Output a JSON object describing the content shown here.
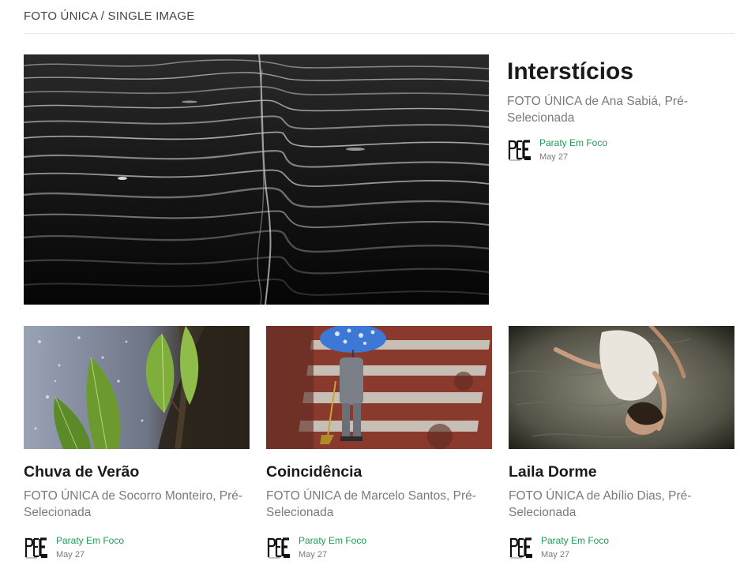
{
  "section": {
    "title": "FOTO ÚNICA / SINGLE IMAGE"
  },
  "featured": {
    "title": "Interstícios",
    "description": "FOTO ÚNICA de Ana Sabiá, Pré-Selecionada",
    "author": "Paraty Em Foco",
    "date": "May 27",
    "image": "black-and-white-water-ripples"
  },
  "posts": [
    {
      "title": "Chuva de Verão",
      "description": "FOTO ÚNICA de Socorro Monteiro, Pré-Selecionada",
      "author": "Paraty Em Foco",
      "date": "May 27",
      "image": "green-leaves-in-rain"
    },
    {
      "title": "Coincidência",
      "description": "FOTO ÚNICA de Marcelo Santos, Pré-Selecionada",
      "author": "Paraty Em Foco",
      "date": "May 27",
      "image": "person-with-blue-umbrella-on-crosswalk"
    },
    {
      "title": "Laila Dorme",
      "description": "FOTO ÚNICA de Abílio Dias, Pré-Selecionada",
      "author": "Paraty Em Foco",
      "date": "May 27",
      "image": "woman-sleeping-on-bed"
    }
  ],
  "colors": {
    "author_link": "#1e9c56",
    "meta_text": "#7a7a7a",
    "title_text": "#1a1a1a"
  }
}
